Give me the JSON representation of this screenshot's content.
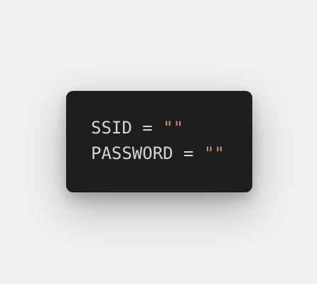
{
  "editor": {
    "lines": [
      {
        "variable": "SSID",
        "operator": "=",
        "value": "\"\""
      },
      {
        "variable": "PASSWORD",
        "operator": "=",
        "value": "\"\""
      }
    ]
  },
  "colors": {
    "page_background": "#f0f0f0",
    "card_background": "#1e1e1e",
    "identifier": "#d4d4d4",
    "string": "#ce9178"
  }
}
